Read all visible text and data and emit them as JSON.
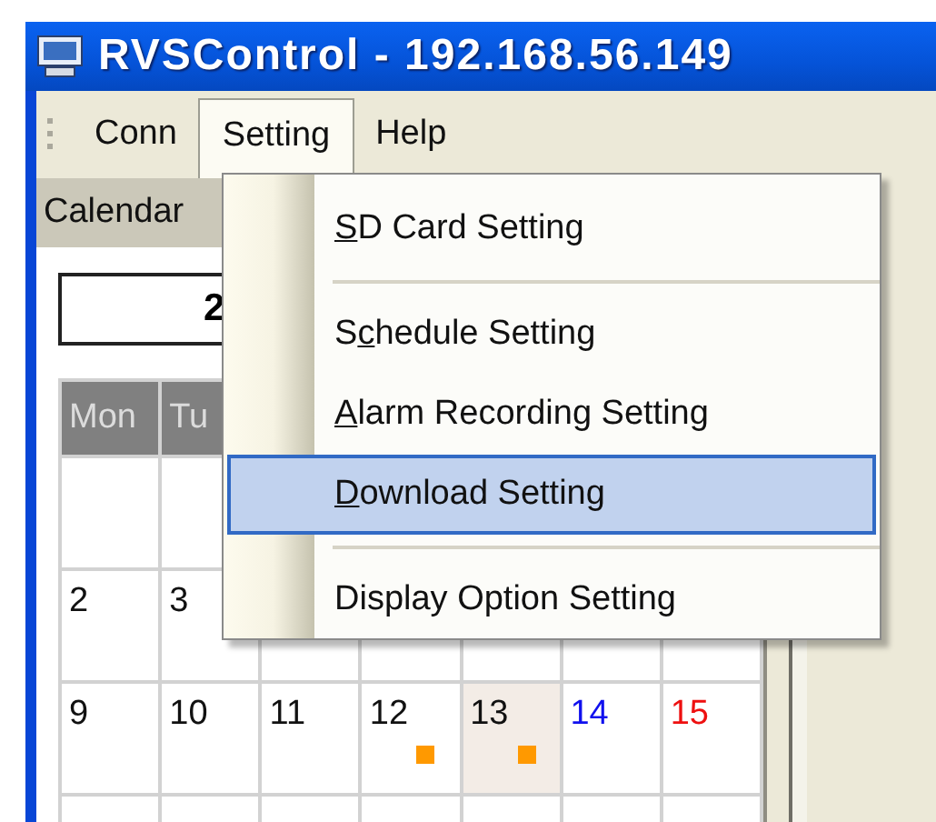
{
  "window": {
    "title": "RVSControl - 192.168.56.149"
  },
  "menu_bar": [
    {
      "label": "Conn",
      "selected": false
    },
    {
      "label": "Setting",
      "selected": true
    },
    {
      "label": "Help",
      "selected": false
    }
  ],
  "setting_menu": [
    {
      "kind": "item",
      "selected": false,
      "parts": [
        {
          "text": "S",
          "underlined": true
        },
        {
          "text": "D Card Setting",
          "underlined": false
        }
      ]
    },
    {
      "kind": "separator"
    },
    {
      "kind": "item",
      "selected": false,
      "parts": [
        {
          "text": "S",
          "underlined": false
        },
        {
          "text": "c",
          "underlined": true
        },
        {
          "text": "hedule Setting",
          "underlined": false
        }
      ]
    },
    {
      "kind": "item",
      "selected": false,
      "parts": [
        {
          "text": "A",
          "underlined": true
        },
        {
          "text": "larm Recording Setting",
          "underlined": false
        }
      ]
    },
    {
      "kind": "item",
      "selected": true,
      "parts": [
        {
          "text": "D",
          "underlined": true
        },
        {
          "text": "ownload Setting",
          "underlined": false
        }
      ]
    },
    {
      "kind": "separator"
    },
    {
      "kind": "item",
      "selected": false,
      "parts": [
        {
          "text": "Display Option Setting",
          "underlined": false
        }
      ]
    }
  ],
  "calendar": {
    "tab": "Calendar",
    "month_field": "2",
    "weekdays": [
      "Mon",
      "Tu"
    ],
    "weeks": [
      [
        {
          "day": "2"
        },
        {
          "day": "3"
        }
      ],
      [
        {
          "day": "9",
          "recording": false,
          "today": false
        },
        {
          "day": "10",
          "recording": false,
          "today": false
        },
        {
          "day": "11",
          "recording": false,
          "today": false
        },
        {
          "day": "12",
          "recording": true,
          "today": false
        },
        {
          "day": "13",
          "recording": true,
          "today": true
        },
        {
          "day": "14",
          "recording": false,
          "today": false
        },
        {
          "day": "15",
          "recording": false,
          "today": false
        }
      ]
    ]
  }
}
